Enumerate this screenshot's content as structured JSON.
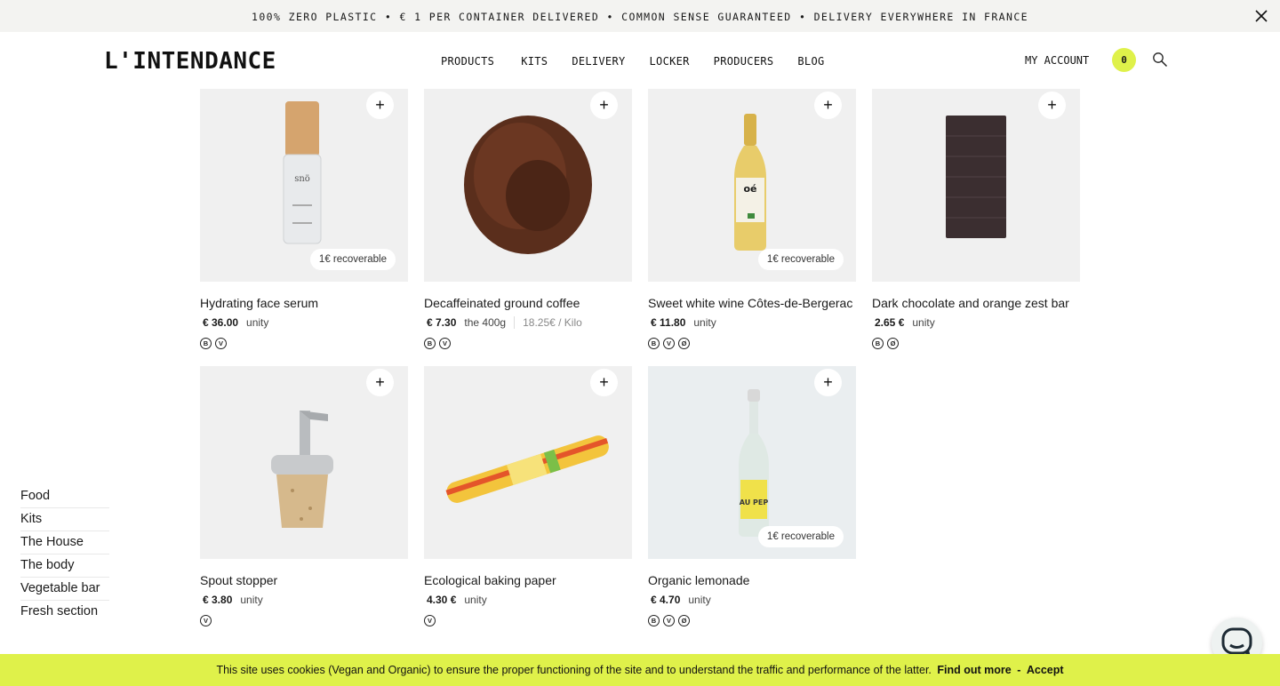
{
  "announcement": {
    "text": "100% ZERO PLASTIC • € 1 PER CONTAINER DELIVERED • COMMON SENSE GUARANTEED • DELIVERY EVERYWHERE IN FRANCE",
    "close_icon": "close-icon"
  },
  "header": {
    "logo": "L'INTENDANCE",
    "nav": [
      "PRODUCTS",
      "KITS",
      "DELIVERY",
      "LOCKER",
      "PRODUCERS",
      "BLOG"
    ],
    "account_label": "MY ACCOUNT",
    "cart_count": "0",
    "search_icon": "search-icon",
    "accent_color": "#dff14a"
  },
  "sidebar": {
    "items": [
      "Food",
      "Kits",
      "The House",
      "The body",
      "Vegetable bar",
      "Fresh section"
    ]
  },
  "products": [
    {
      "name": "Hydrating face serum",
      "price": "€ 36.00",
      "unit": "unity",
      "per_kilo": "",
      "badge": "1€ recoverable",
      "labels": [
        "B",
        "V"
      ]
    },
    {
      "name": "Decaffeinated ground coffee",
      "price": "€ 7.30",
      "unit": "the 400g",
      "per_kilo": "18.25€ / Kilo",
      "badge": "",
      "labels": [
        "B",
        "V"
      ]
    },
    {
      "name": "Sweet white wine Côtes-de-Bergerac",
      "price": "€ 11.80",
      "unit": "unity",
      "per_kilo": "",
      "badge": "1€ recoverable",
      "labels": [
        "B",
        "V",
        "Ø"
      ]
    },
    {
      "name": "Dark chocolate and orange zest bar",
      "price": "2.65 €",
      "unit": "unity",
      "per_kilo": "",
      "badge": "",
      "labels": [
        "B",
        "Ø"
      ]
    },
    {
      "name": "Spout stopper",
      "price": "€ 3.80",
      "unit": "unity",
      "per_kilo": "",
      "badge": "",
      "labels": [
        "V"
      ]
    },
    {
      "name": "Ecological baking paper",
      "price": "4.30 €",
      "unit": "unity",
      "per_kilo": "",
      "badge": "",
      "labels": [
        "V"
      ]
    },
    {
      "name": "Organic lemonade",
      "price": "€ 4.70",
      "unit": "unity",
      "per_kilo": "",
      "badge": "1€ recoverable",
      "labels": [
        "B",
        "V",
        "Ø"
      ]
    }
  ],
  "add_button_label": "+",
  "cookie": {
    "text": "This site uses cookies (Vegan and Organic) to ensure the proper functioning of the site and to understand the traffic and performance of the latter.",
    "find_out_more": "Find out more",
    "separator": "-",
    "accept": "Accept"
  },
  "chat_icon": "chat-icon"
}
